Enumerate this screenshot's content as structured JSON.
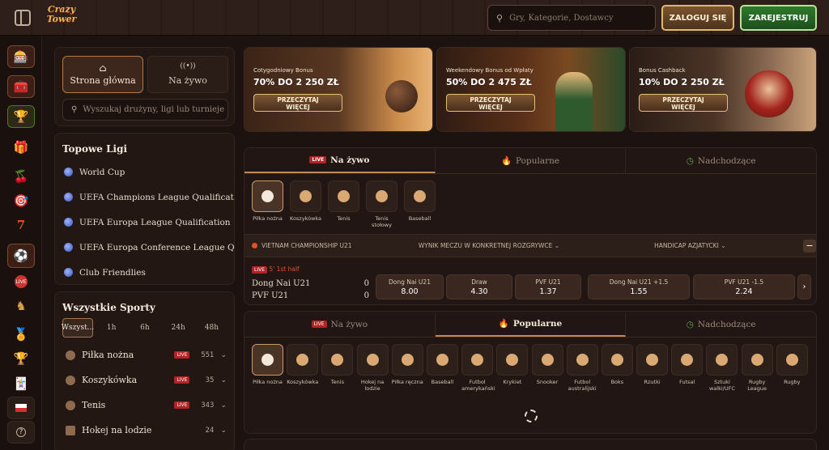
{
  "topbar": {
    "logo_line1": "Crazy",
    "logo_line2": "Tower",
    "search_placeholder": "Gry, Kategorie, Dostawcy",
    "login_label": "ZALOGUJ SIĘ",
    "register_label": "ZAREJESTRUJ"
  },
  "rail": [
    {
      "name": "slots-icon",
      "glyph": "🎰"
    },
    {
      "name": "chest-icon",
      "glyph": "🧰"
    },
    {
      "name": "trophy-cup-icon",
      "glyph": "🏆"
    },
    {
      "name": "gift-icon",
      "glyph": "🎁"
    },
    {
      "name": "cherries-icon",
      "glyph": "🍒"
    },
    {
      "name": "roulette-icon",
      "glyph": "🎯"
    },
    {
      "name": "seven-icon",
      "glyph": "7"
    },
    {
      "name": "football-icon",
      "glyph": "⚽"
    },
    {
      "name": "live-icon",
      "glyph": "LIVE"
    },
    {
      "name": "horse-icon",
      "glyph": "♞"
    },
    {
      "name": "medal-icon",
      "glyph": "🏅"
    },
    {
      "name": "cup-icon",
      "glyph": "🏆"
    },
    {
      "name": "cards-icon",
      "glyph": "🃏"
    },
    {
      "name": "flag-pl-icon",
      "glyph": ""
    },
    {
      "name": "help-icon",
      "glyph": "?"
    }
  ],
  "sidebar": {
    "tab_home": "Strona główna",
    "tab_live": "Na żywo",
    "search_placeholder": "Wyszukaj drużyny, ligi lub turnieje",
    "top_leagues_title": "Topowe Ligi",
    "leagues": [
      "World Cup",
      "UEFA Champions League Qualification",
      "UEFA Europa League Qualification",
      "UEFA Europa Conference League Qual...",
      "Club Friendlies"
    ],
    "all_sports_title": "Wszystkie Sporty",
    "filters": [
      "Wszyst...",
      "1h",
      "6h",
      "24h",
      "48h"
    ],
    "sports": [
      {
        "name": "Piłka nożna",
        "live": "LIVE",
        "count": "551"
      },
      {
        "name": "Koszykówka",
        "live": "LIVE",
        "count": "35"
      },
      {
        "name": "Tenis",
        "live": "LIVE",
        "count": "343"
      },
      {
        "name": "Hokej na lodzie",
        "live": "",
        "count": "24"
      }
    ]
  },
  "banners": [
    {
      "sub": "Cotygodniowy Bonus",
      "amount": "70% DO 2 250 ZŁ",
      "cta1": "PRZECZYTAJ",
      "cta2": "WIĘCEJ"
    },
    {
      "sub": "Weekendowy Bonus od Wpłaty",
      "amount": "50% DO 2 475 ZŁ",
      "cta1": "PRZECZYTAJ",
      "cta2": "WIĘCEJ"
    },
    {
      "sub": "Bonus Cashback",
      "amount": "10% DO 2 250 ZŁ",
      "cta1": "PRZECZYTAJ",
      "cta2": "WIĘCEJ"
    }
  ],
  "panel1": {
    "tabs": [
      {
        "label": "Na żywo",
        "badge": "LIVE"
      },
      {
        "label": "Popularne"
      },
      {
        "label": "Nadchodzące"
      }
    ],
    "sports": [
      {
        "label1": "Piłka nożna",
        "label2": ""
      },
      {
        "label1": "Koszykówka",
        "label2": ""
      },
      {
        "label1": "Tenis",
        "label2": ""
      },
      {
        "label1": "Tenis",
        "label2": "stołowy"
      },
      {
        "label1": "Baseball",
        "label2": ""
      }
    ],
    "league": "VIETNAM CHAMPIONSHIP U21",
    "market1": "WYNIK MECZU W KONKRETNEJ ROZGRYWCE",
    "market2": "HANDICAP AZJATYCKI",
    "match": {
      "time": "5' 1st half",
      "team1": "Dong Nai U21",
      "score1": "0",
      "team2": "PVF U21",
      "score2": "0",
      "odds": [
        {
          "name": "Dong Nai U21",
          "value": "8.00"
        },
        {
          "name": "Draw",
          "value": "4.30"
        },
        {
          "name": "PVF U21",
          "value": "1.37"
        },
        {
          "name": "Dong Nai U21 +1.5",
          "value": "1.55"
        },
        {
          "name": "PVF U21 -1.5",
          "value": "2.24"
        }
      ]
    }
  },
  "panel2": {
    "tabs": [
      {
        "label": "Na żywo",
        "badge": "LIVE"
      },
      {
        "label": "Popularne"
      },
      {
        "label": "Nadchodzące"
      }
    ],
    "sports": [
      {
        "label1": "Piłka nożna",
        "label2": ""
      },
      {
        "label1": "Koszykówka",
        "label2": ""
      },
      {
        "label1": "Tenis",
        "label2": ""
      },
      {
        "label1": "Hokej na",
        "label2": "lodzie"
      },
      {
        "label1": "Piłka ręczna",
        "label2": ""
      },
      {
        "label1": "Baseball",
        "label2": ""
      },
      {
        "label1": "Futbol",
        "label2": "amerykański"
      },
      {
        "label1": "Krykiet",
        "label2": ""
      },
      {
        "label1": "Snooker",
        "label2": ""
      },
      {
        "label1": "Futbol",
        "label2": "australijski"
      },
      {
        "label1": "Boks",
        "label2": ""
      },
      {
        "label1": "Rzutki",
        "label2": ""
      },
      {
        "label1": "Futsal",
        "label2": ""
      },
      {
        "label1": "Sztuki",
        "label2": "walki/UFC"
      },
      {
        "label1": "Rugby",
        "label2": "League"
      },
      {
        "label1": "Rugby",
        "label2": ""
      }
    ]
  },
  "colors": {
    "accent": "#c08a55",
    "live": "#b22424",
    "register": "#2f7a2d"
  }
}
